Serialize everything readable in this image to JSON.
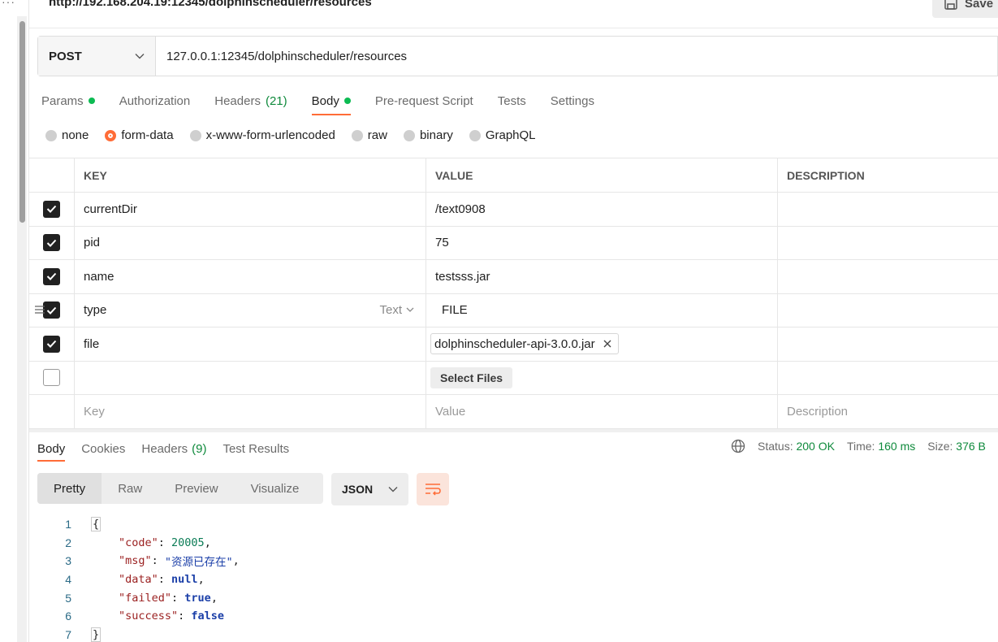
{
  "header": {
    "url_title": "http://192.168.204.19:12345/dolphinscheduler/resources",
    "save_label": "Save"
  },
  "request": {
    "method": "POST",
    "url": "127.0.0.1:12345/dolphinscheduler/resources"
  },
  "tabs": [
    {
      "label": "Params",
      "count": "",
      "dot": true
    },
    {
      "label": "Authorization",
      "count": "",
      "dot": false
    },
    {
      "label": "Headers",
      "count": "(21)",
      "dot": false
    },
    {
      "label": "Body",
      "count": "",
      "dot": true
    },
    {
      "label": "Pre-request Script",
      "count": "",
      "dot": false
    },
    {
      "label": "Tests",
      "count": "",
      "dot": false
    },
    {
      "label": "Settings",
      "count": "",
      "dot": false
    }
  ],
  "body_types": [
    "none",
    "form-data",
    "x-www-form-urlencoded",
    "raw",
    "binary",
    "GraphQL"
  ],
  "body_type_selected": "form-data",
  "table": {
    "headers": {
      "key": "KEY",
      "value": "VALUE",
      "description": "DESCRIPTION"
    },
    "rows": [
      {
        "key": "currentDir",
        "value": "/text0908",
        "checked": true
      },
      {
        "key": "pid",
        "value": "75",
        "checked": true
      },
      {
        "key": "name",
        "value": "testsss.jar",
        "checked": true
      },
      {
        "key": "type",
        "value": "FILE",
        "checked": true,
        "type_label": "Text"
      },
      {
        "key": "file",
        "value": "dolphinscheduler-api-3.0.0.jar",
        "checked": true
      }
    ],
    "select_files_label": "Select Files",
    "placeholders": {
      "key": "Key",
      "value": "Value",
      "description": "Description"
    }
  },
  "response": {
    "tabs": [
      {
        "label": "Body",
        "count": ""
      },
      {
        "label": "Cookies",
        "count": ""
      },
      {
        "label": "Headers",
        "count": "(9)"
      },
      {
        "label": "Test Results",
        "count": ""
      }
    ],
    "status_label": "Status:",
    "status_value": "200 OK",
    "time_label": "Time:",
    "time_value": "160 ms",
    "size_label": "Size:",
    "size_value": "376 B",
    "view_modes": [
      "Pretty",
      "Raw",
      "Preview",
      "Visualize"
    ],
    "format": "JSON",
    "line_numbers": [
      "1",
      "2",
      "3",
      "4",
      "5",
      "6",
      "7"
    ],
    "json": {
      "open": "{",
      "close": "}",
      "code_key": "\"code\"",
      "code_val": "20005",
      "msg_key": "\"msg\"",
      "msg_val": "\"资源已存在\"",
      "data_key": "\"data\"",
      "data_val": "null",
      "failed_key": "\"failed\"",
      "failed_val": "true",
      "success_key": "\"success\"",
      "success_val": "false"
    }
  },
  "colors": {
    "accent": "#ff6c37",
    "success": "#0f8a3c",
    "dot": "#0cbb52"
  }
}
